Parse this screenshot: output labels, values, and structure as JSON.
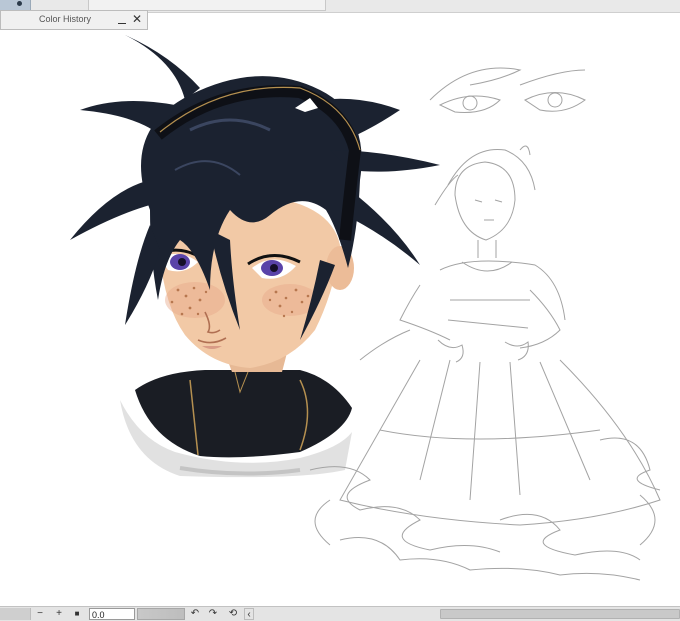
{
  "panel": {
    "title": "Color History",
    "close_glyph": "✕"
  },
  "statusbar": {
    "zoom_out_glyph": "−",
    "zoom_in_glyph": "+",
    "stop_glyph": "■",
    "zoom_value": "0.0",
    "rotate_left_glyph": "↶",
    "rotate_right_glyph": "↷",
    "reset_rotation_glyph": "⟲",
    "scroll_left_glyph": "‹"
  },
  "icons": {
    "close": "close-icon",
    "minimize": "minimize-icon",
    "zoom_out": "zoom-out-icon",
    "zoom_in": "zoom-in-icon",
    "rotate_left": "rotate-left-icon",
    "rotate_right": "rotate-right-icon",
    "reset_rotation": "reset-rotation-icon"
  },
  "colors": {
    "canvas": "#ffffff",
    "hair": "#1b2230",
    "skin": "#f2c9a6",
    "freckles": "#b7774f",
    "eyes": "#5a43a8",
    "sketch": "#9c9c9c",
    "chrome": "#e4e4e4"
  }
}
